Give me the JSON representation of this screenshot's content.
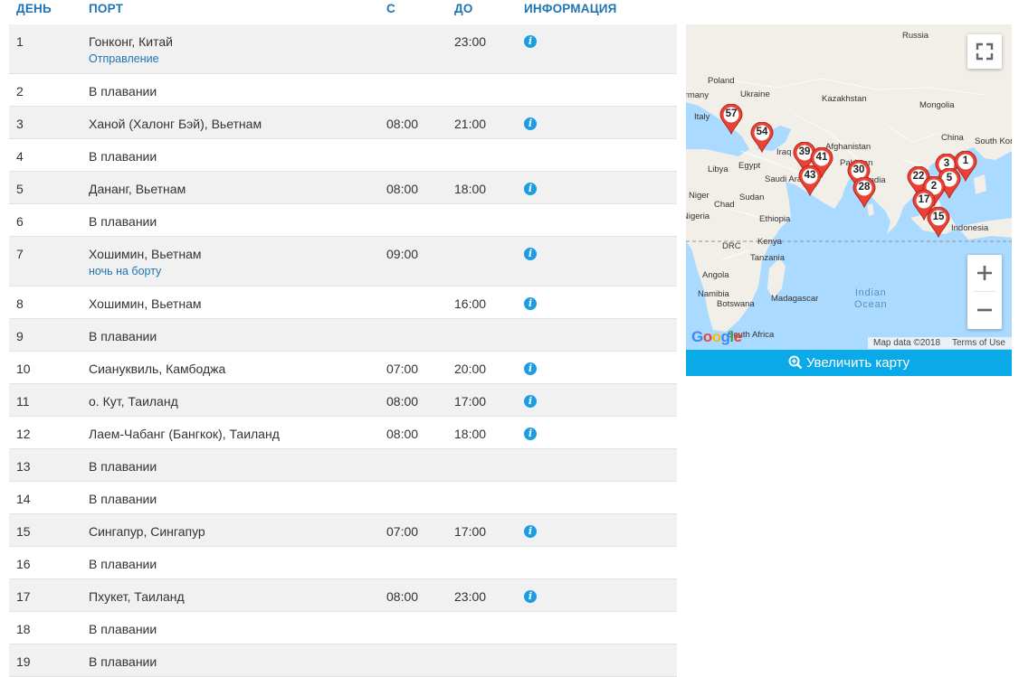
{
  "table": {
    "headers": {
      "day": "ДЕНЬ",
      "port": "ПОРТ",
      "from": "С",
      "to": "ДО",
      "info": "ИНФОРМАЦИЯ"
    },
    "rows": [
      {
        "day": "1",
        "port": "Гонконг, Китай",
        "note": "Отправление",
        "from": "",
        "to": "23:00",
        "info": true
      },
      {
        "day": "2",
        "port": "В плавании",
        "note": "",
        "from": "",
        "to": "",
        "info": false
      },
      {
        "day": "3",
        "port": "Ханой (Халонг Бэй), Вьетнам",
        "note": "",
        "from": "08:00",
        "to": "21:00",
        "info": true
      },
      {
        "day": "4",
        "port": "В плавании",
        "note": "",
        "from": "",
        "to": "",
        "info": false
      },
      {
        "day": "5",
        "port": "Дананг, Вьетнам",
        "note": "",
        "from": "08:00",
        "to": "18:00",
        "info": true
      },
      {
        "day": "6",
        "port": "В плавании",
        "note": "",
        "from": "",
        "to": "",
        "info": false
      },
      {
        "day": "7",
        "port": "Хошимин, Вьетнам",
        "note": "ночь на борту",
        "from": "09:00",
        "to": "",
        "info": true
      },
      {
        "day": "8",
        "port": "Хошимин, Вьетнам",
        "note": "",
        "from": "",
        "to": "16:00",
        "info": true
      },
      {
        "day": "9",
        "port": "В плавании",
        "note": "",
        "from": "",
        "to": "",
        "info": false
      },
      {
        "day": "10",
        "port": "Сиануквиль, Камбоджа",
        "note": "",
        "from": "07:00",
        "to": "20:00",
        "info": true
      },
      {
        "day": "11",
        "port": "о. Кут, Таиланд",
        "note": "",
        "from": "08:00",
        "to": "17:00",
        "info": true
      },
      {
        "day": "12",
        "port": "Лаем-Чабанг (Бангкок), Таиланд",
        "note": "",
        "from": "08:00",
        "to": "18:00",
        "info": true
      },
      {
        "day": "13",
        "port": "В плавании",
        "note": "",
        "from": "",
        "to": "",
        "info": false
      },
      {
        "day": "14",
        "port": "В плавании",
        "note": "",
        "from": "",
        "to": "",
        "info": false
      },
      {
        "day": "15",
        "port": "Сингапур, Сингапур",
        "note": "",
        "from": "07:00",
        "to": "17:00",
        "info": true
      },
      {
        "day": "16",
        "port": "В плавании",
        "note": "",
        "from": "",
        "to": "",
        "info": false
      },
      {
        "day": "17",
        "port": "Пхукет, Таиланд",
        "note": "",
        "from": "08:00",
        "to": "23:00",
        "info": true
      },
      {
        "day": "18",
        "port": "В плавании",
        "note": "",
        "from": "",
        "to": "",
        "info": false
      },
      {
        "day": "19",
        "port": "В плавании",
        "note": "",
        "from": "",
        "to": "",
        "info": false
      }
    ],
    "info_icon": "info-icon",
    "info_glyph": "i"
  },
  "map": {
    "labels": [
      "Russia",
      "Poland",
      "Ukraine",
      "Kazakhstan",
      "Mongolia",
      "Germany",
      "Italy",
      "China",
      "South Kor",
      "Afghanistan",
      "Iraq",
      "Pakistan",
      "Libya",
      "Egypt",
      "Saudi Arabia",
      "India",
      "Niger",
      "Chad",
      "Sudan",
      "Ethiopia",
      "Nigeria",
      "DRC",
      "Kenya",
      "Tanzania",
      "Angola",
      "Namibia",
      "Botswana",
      "Madagascar",
      "South Africa",
      "Indonesia"
    ],
    "ocean_label": [
      "Indian",
      "Ocean"
    ],
    "markers": [
      "57",
      "54",
      "39",
      "41",
      "43",
      "30",
      "28",
      "22",
      "3",
      "1",
      "5",
      "2",
      "17",
      "15"
    ],
    "attribution": {
      "data": "Map data ©2018",
      "terms": "Terms of Use"
    },
    "logo": "Google",
    "controls": {
      "fullscreen": "fullscreen-icon",
      "zoom_in": "+",
      "zoom_out": "−"
    },
    "colors": {
      "water": "#aadaff",
      "land": "#f2efe9",
      "marker": "#ea4335",
      "accent": "#0aaae9"
    }
  },
  "enlarge_button": {
    "label": "Увеличить карту",
    "icon": "zoom-in-icon"
  }
}
